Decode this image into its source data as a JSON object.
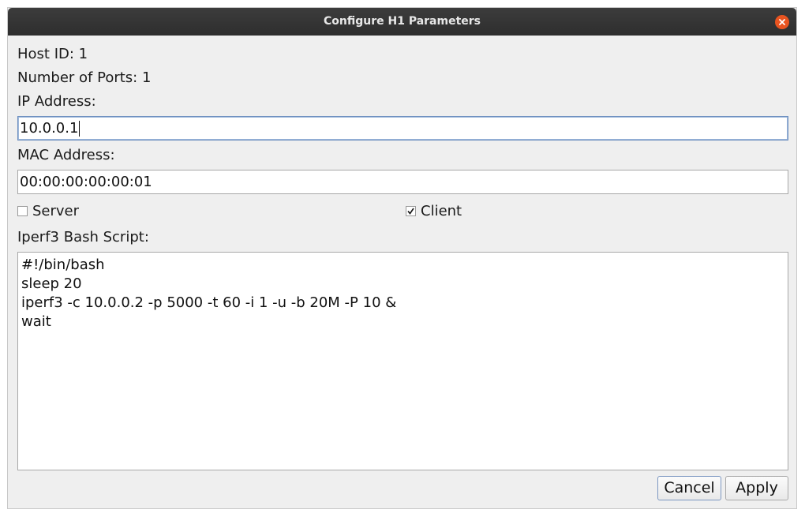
{
  "window": {
    "title": "Configure H1 Parameters"
  },
  "host": {
    "host_id_label": "Host ID: 1",
    "ports_label": "Number of Ports: 1"
  },
  "ip": {
    "label": "IP Address:",
    "value": "10.0.0.1"
  },
  "mac": {
    "label": "MAC Address:",
    "value": "00:00:00:00:00:01"
  },
  "mode": {
    "server_label": "Server",
    "server_checked": false,
    "client_label": "Client",
    "client_checked": true
  },
  "script": {
    "label": "Iperf3 Bash Script:",
    "lines": [
      "#!/bin/bash",
      "sleep 20",
      "iperf3 -c 10.0.0.2 -p 5000 -t 60 -i 1 -u -b 20M -P 10 &",
      "wait"
    ]
  },
  "buttons": {
    "cancel_label": "Cancel",
    "apply_label": "Apply"
  },
  "colors": {
    "titlebar": "#333333",
    "close_button": "#e95420",
    "focus_border": "#6d8fbf"
  }
}
